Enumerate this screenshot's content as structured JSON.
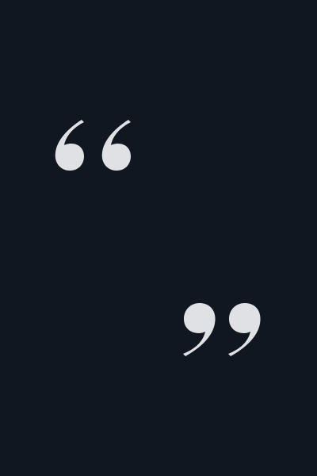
{
  "quote_graphic": {
    "open_mark_icon": "opening-double-quote-icon",
    "close_mark_icon": "closing-double-quote-icon"
  },
  "colors": {
    "background": "#111720",
    "quote_mark": "#dfe1e4"
  }
}
